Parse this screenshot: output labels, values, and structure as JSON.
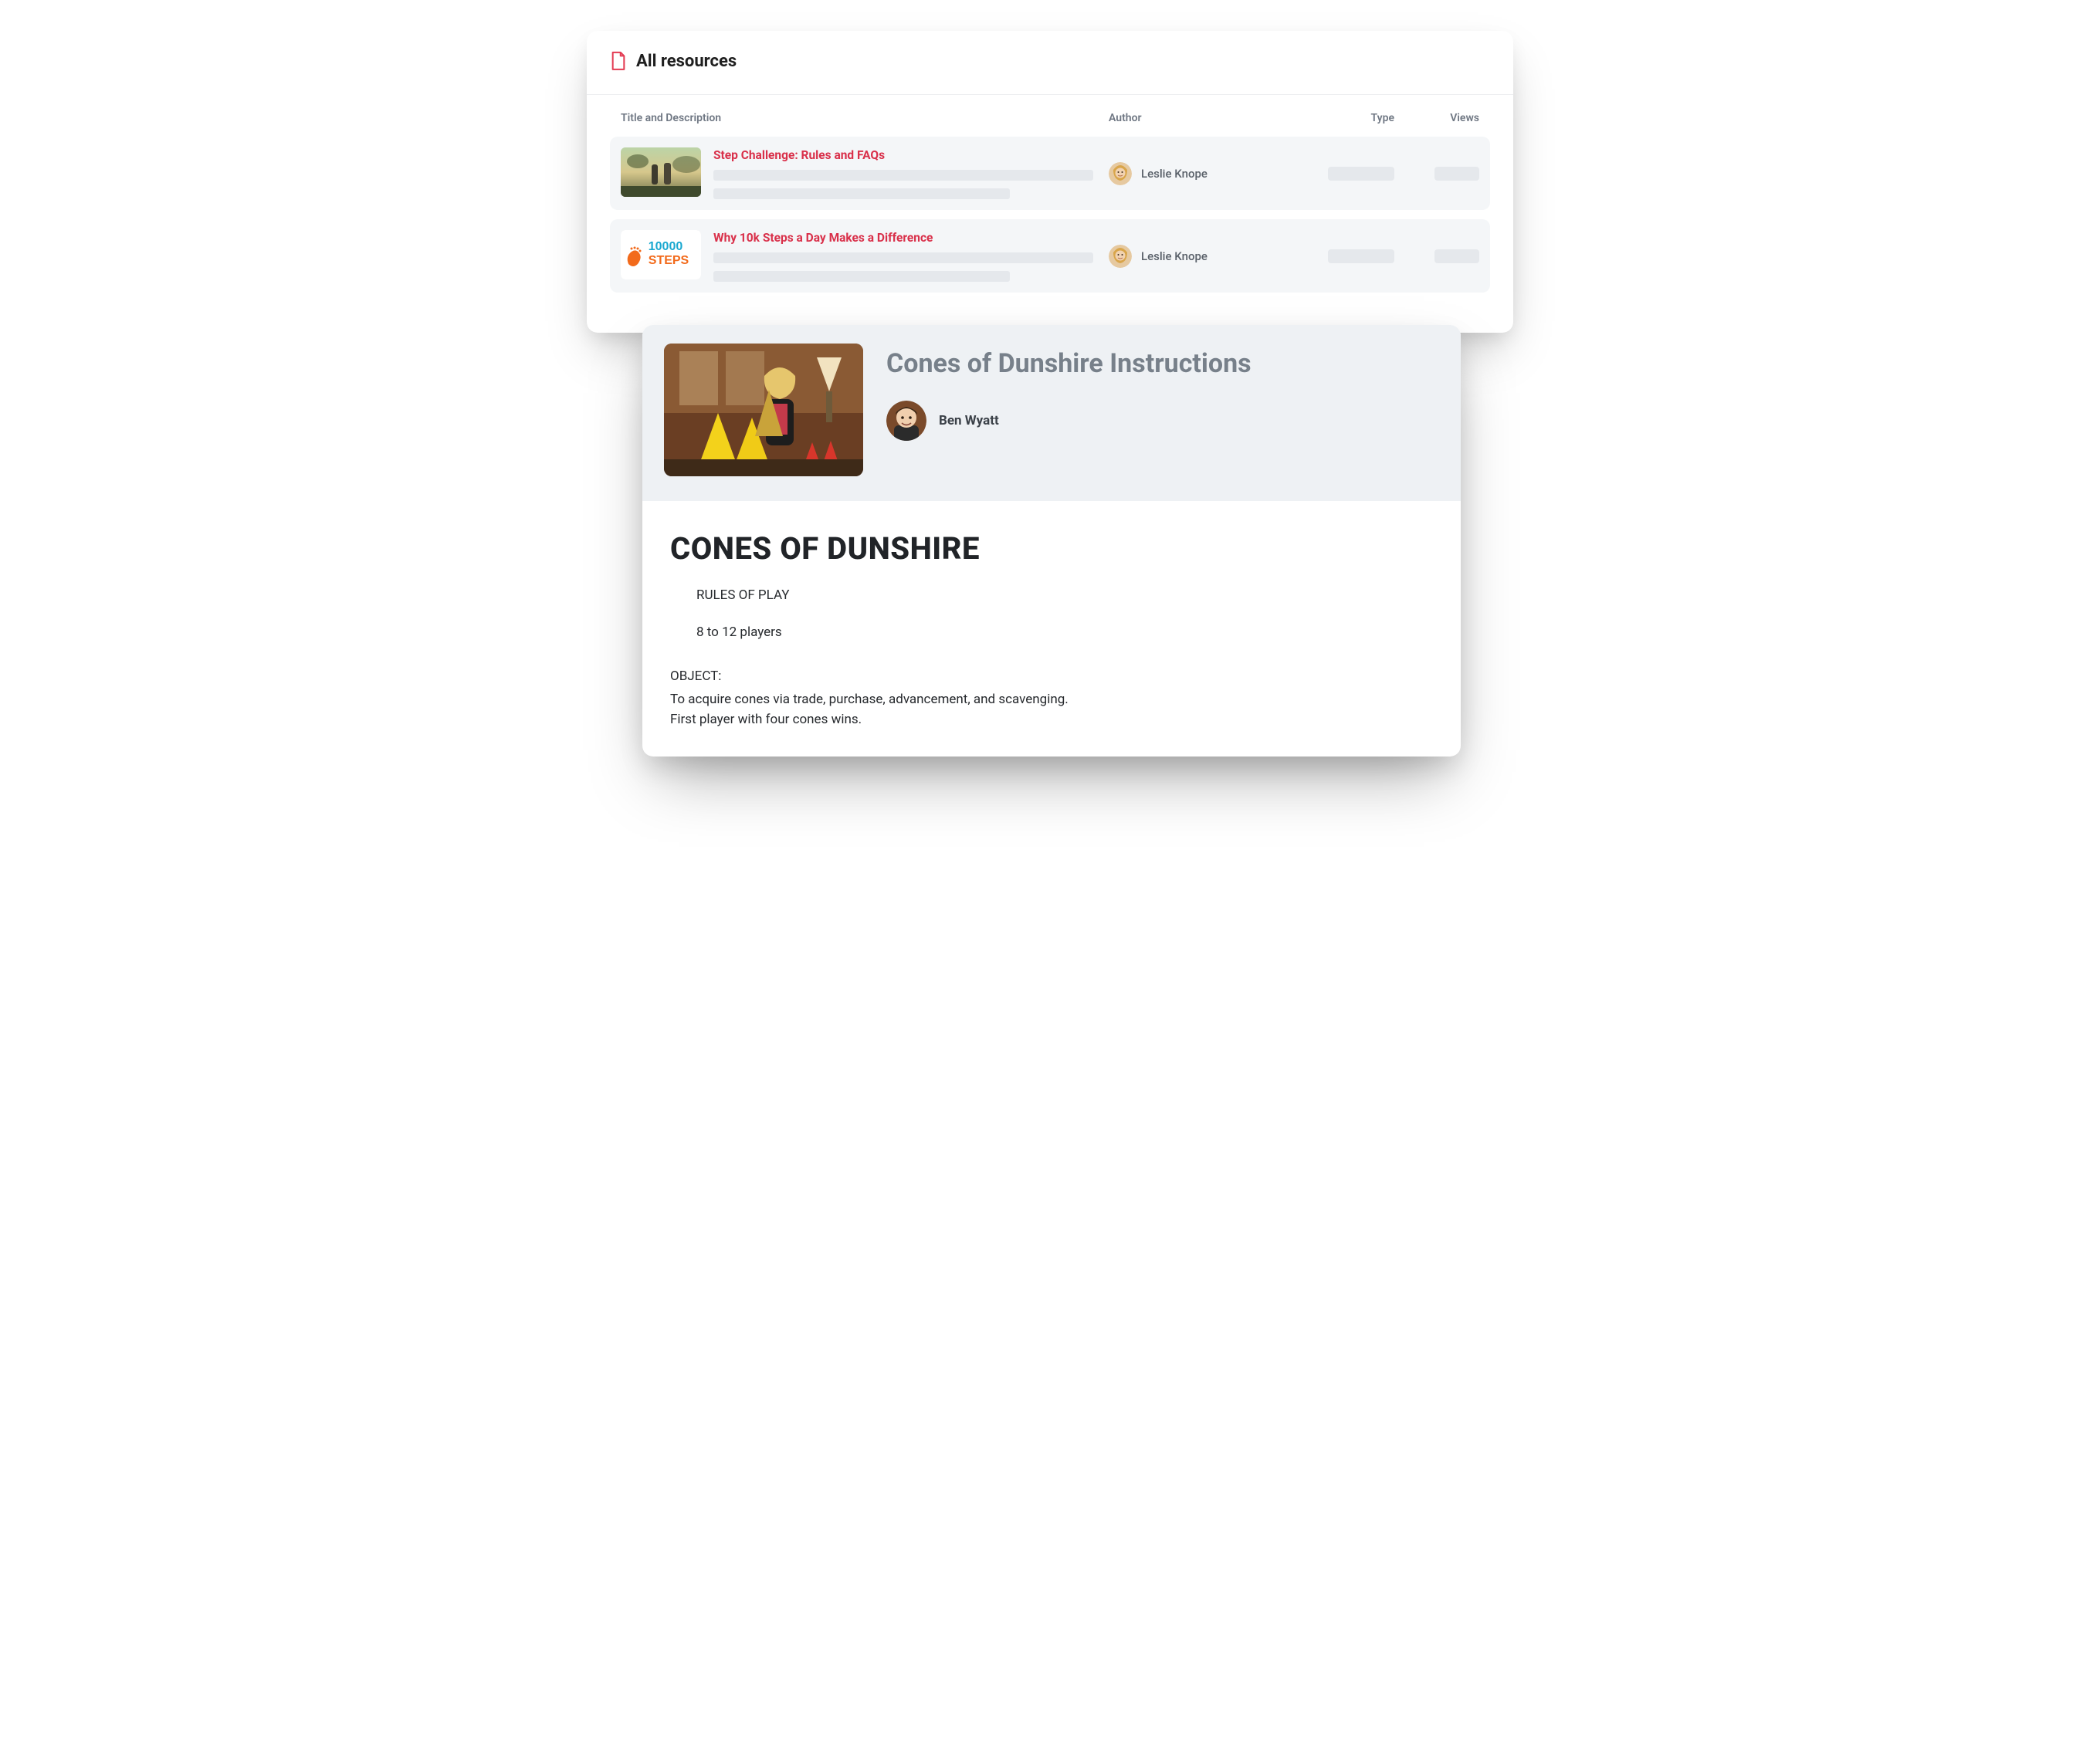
{
  "header": {
    "title": "All resources",
    "icon": "file-icon"
  },
  "columns": {
    "title": "Title and Description",
    "author": "Author",
    "type": "Type",
    "views": "Views"
  },
  "rows": [
    {
      "title": "Step Challenge: Rules and FAQs",
      "author": "Leslie Knope",
      "thumb": "outdoor-photo"
    },
    {
      "title": "Why 10k Steps a Day Makes a Difference",
      "author": "Leslie Knope",
      "thumb": "10000-steps-graphic"
    }
  ],
  "detail": {
    "title": "Cones of Dunshire Instructions",
    "author": "Ben Wyatt",
    "body": {
      "heading": "CONES OF DUNSHIRE",
      "rules_label": "RULES OF PLAY",
      "players": "8 to 12 players",
      "object_label": "OBJECT:",
      "object_text": "To acquire cones via trade, purchase, advancement, and scavenging. First player with four cones wins."
    }
  },
  "colors": {
    "accent": "#d9304a",
    "muted": "#77808a"
  }
}
